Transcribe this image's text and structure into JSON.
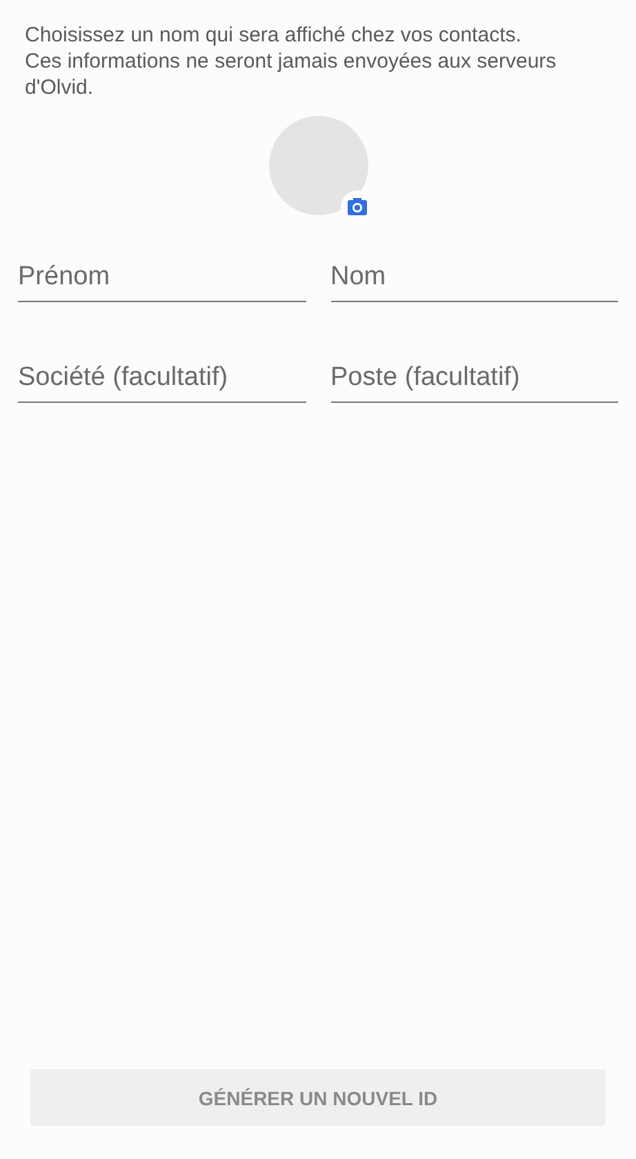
{
  "intro": "Choisissez un nom qui sera affiché chez vos contacts.\nCes informations ne seront jamais envoyées aux serveurs d'Olvid.",
  "fields": [
    {
      "placeholder": "Prénom"
    },
    {
      "placeholder": "Nom"
    },
    {
      "placeholder": "Société (facultatif)"
    },
    {
      "placeholder": "Poste (facultatif)"
    }
  ],
  "button": {
    "label": "GÉNÉRER UN NOUVEL ID",
    "disabled": true
  }
}
